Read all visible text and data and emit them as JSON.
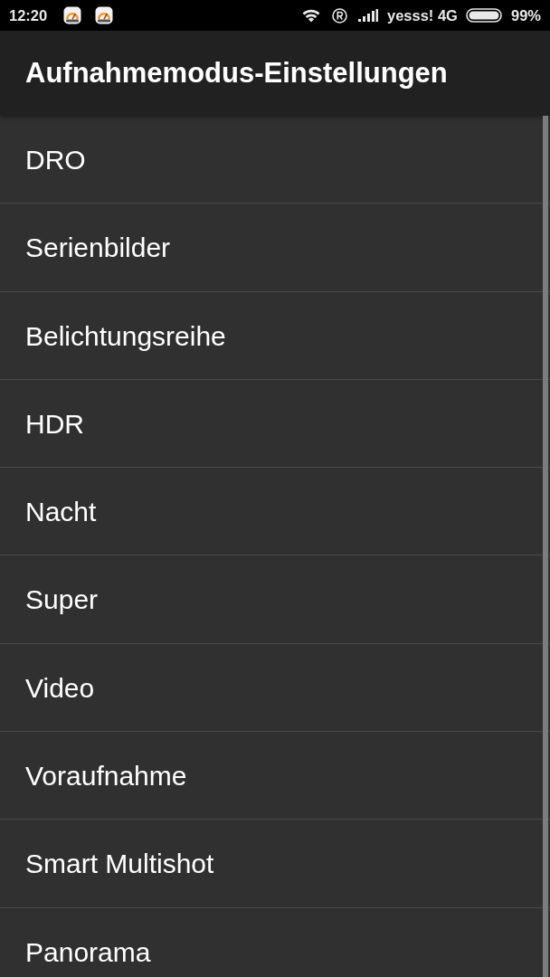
{
  "status_bar": {
    "time": "12:20",
    "carrier": "yesss! 4G",
    "battery": "99%"
  },
  "app_bar": {
    "title": "Aufnahmemodus-Einstellungen"
  },
  "items": [
    {
      "label": "DRO"
    },
    {
      "label": "Serienbilder"
    },
    {
      "label": "Belichtungsreihe"
    },
    {
      "label": "HDR"
    },
    {
      "label": "Nacht"
    },
    {
      "label": "Super"
    },
    {
      "label": "Video"
    },
    {
      "label": "Voraufnahme"
    },
    {
      "label": "Smart Multishot"
    },
    {
      "label": "Panorama"
    }
  ]
}
